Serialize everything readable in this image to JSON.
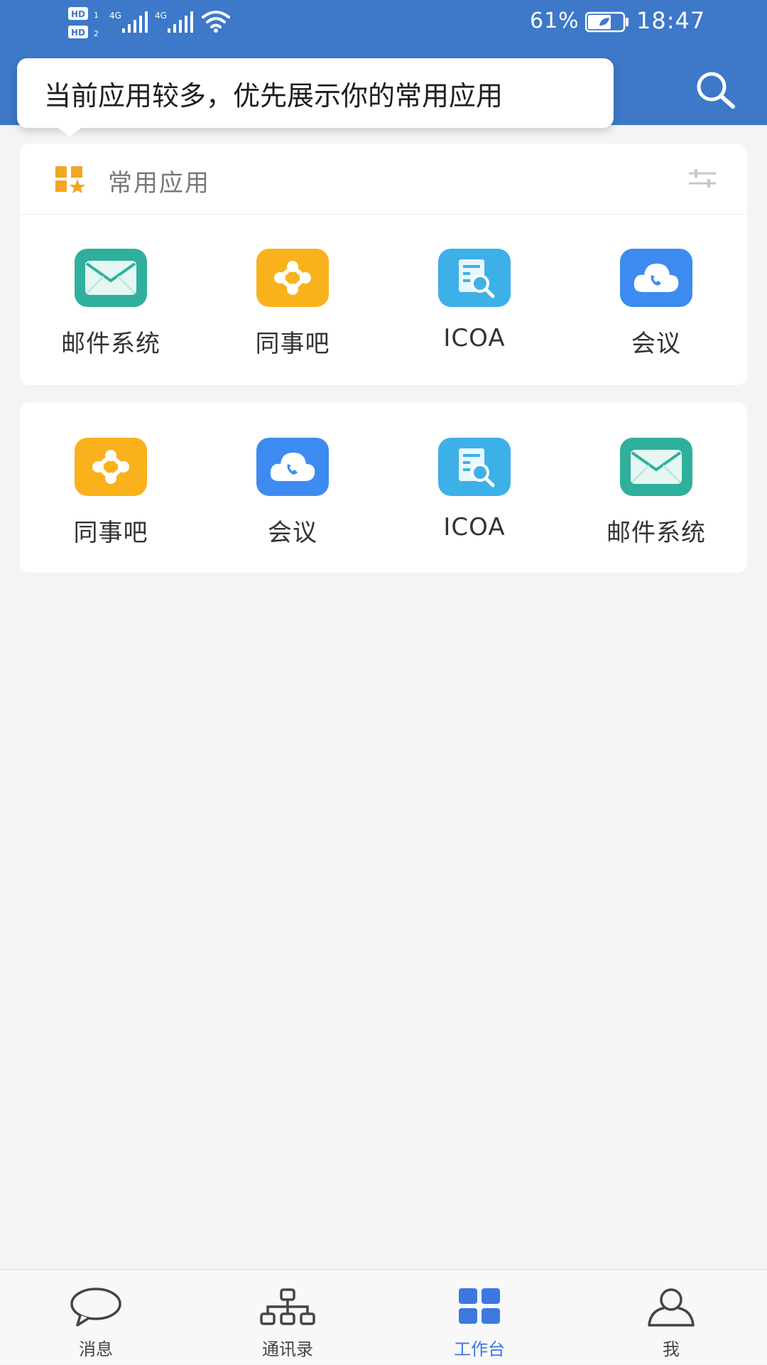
{
  "status_bar": {
    "sim1": "HD 1",
    "sim2": "HD 2",
    "network1": "4G",
    "network2": "4G",
    "battery_percent": "61%",
    "time": "18:47"
  },
  "header": {
    "search_icon": "search-icon",
    "accent_color": "#3d78c9"
  },
  "tooltip": {
    "text": "当前应用较多，优先展示你的常用应用"
  },
  "favorites": {
    "title": "常用应用",
    "apps": [
      {
        "label": "邮件系统",
        "icon": "mail-icon"
      },
      {
        "label": "同事吧",
        "icon": "network-icon"
      },
      {
        "label": "ICOA",
        "icon": "document-search-icon"
      },
      {
        "label": "会议",
        "icon": "cloud-phone-icon"
      }
    ]
  },
  "all_apps": {
    "apps": [
      {
        "label": "同事吧",
        "icon": "network-icon"
      },
      {
        "label": "会议",
        "icon": "cloud-phone-icon"
      },
      {
        "label": "ICOA",
        "icon": "document-search-icon"
      },
      {
        "label": "邮件系统",
        "icon": "mail-icon"
      }
    ]
  },
  "tabbar": {
    "active_color": "#3d78e0",
    "tabs": [
      {
        "label": "消息",
        "icon": "chat-bubble-icon"
      },
      {
        "label": "通讯录",
        "icon": "org-chart-icon"
      },
      {
        "label": "工作台",
        "icon": "workspace-grid-icon",
        "active": true
      },
      {
        "label": "我",
        "icon": "person-icon"
      }
    ]
  }
}
